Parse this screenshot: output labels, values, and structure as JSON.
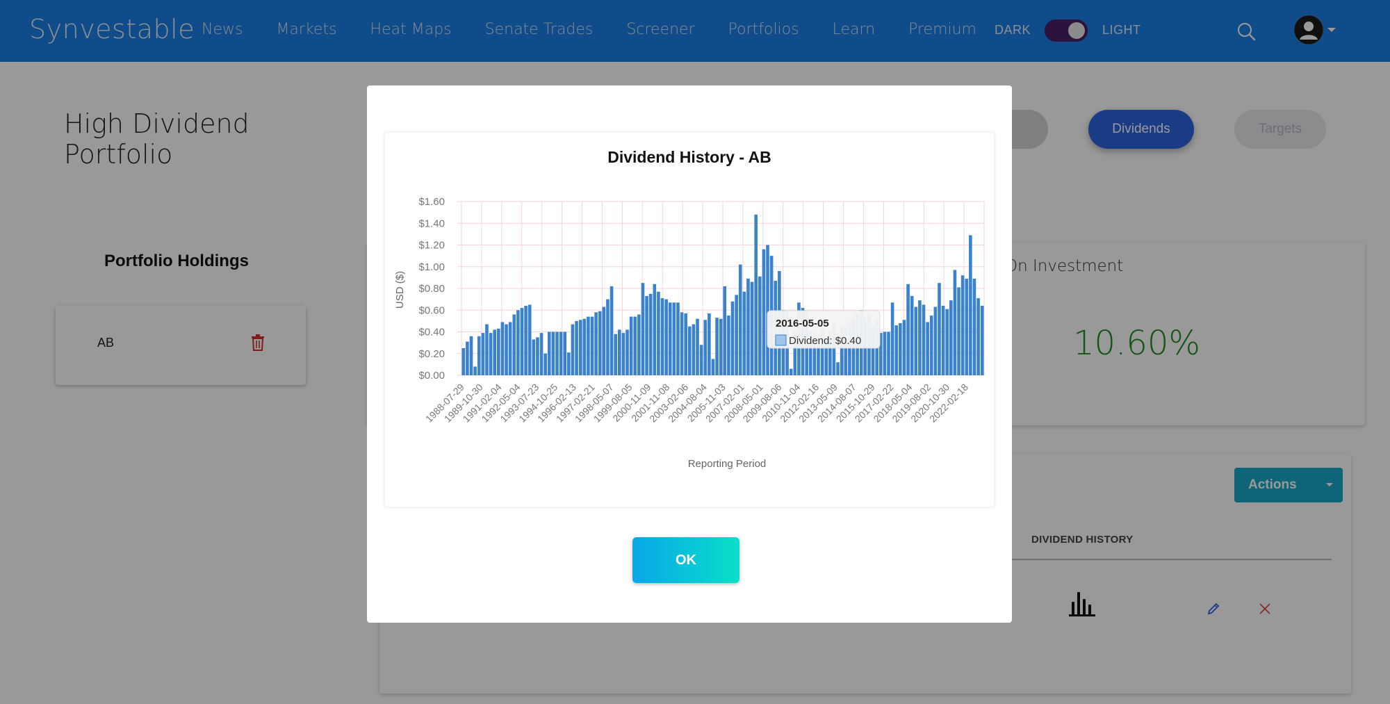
{
  "brand": "Synvestable",
  "nav": {
    "items": [
      "News",
      "Markets",
      "Heat Maps",
      "Senate Trades",
      "Screener",
      "Portfolios",
      "Learn",
      "Premium"
    ],
    "dark_label": "DARK",
    "light_label": "LIGHT"
  },
  "page": {
    "title_line1": "High Dividend",
    "title_line2": "Portfolio",
    "tabs": {
      "dividends": "Dividends",
      "targets": "Targets"
    },
    "holdings_title": "Portfolio Holdings",
    "holdings": [
      {
        "symbol": "AB"
      }
    ],
    "roi_label": "On Investment",
    "roi_value": "10.60%",
    "actions_label": "Actions",
    "column_header": "DIVIDEND HISTORY"
  },
  "modal": {
    "ok_label": "OK",
    "tooltip": {
      "date": "2016-05-05",
      "label": "Dividend: $0.40"
    }
  },
  "colors": {
    "nav_bg": "#1b7fe5",
    "bar": "#3a82cc",
    "roi_positive": "#1e8c1e",
    "dividends_tab": "#2c63e0"
  },
  "chart_data": {
    "type": "bar",
    "title": "Dividend History - AB",
    "xlabel": "Reporting Period",
    "ylabel": "USD ($)",
    "ylim": [
      0,
      1.6
    ],
    "y_ticks": [
      "$0.00",
      "$0.20",
      "$0.40",
      "$0.60",
      "$0.80",
      "$1.00",
      "$1.20",
      "$1.40",
      "$1.60"
    ],
    "x_tick_labels": [
      "1988-07-29",
      "1989-10-30",
      "1991-02-04",
      "1992-05-04",
      "1993-07-23",
      "1994-10-25",
      "1996-02-13",
      "1997-02-21",
      "1998-05-07",
      "1999-08-05",
      "2000-11-09",
      "2001-11-08",
      "2003-02-06",
      "2004-08-04",
      "2005-11-03",
      "2007-02-01",
      "2008-05-01",
      "2009-08-06",
      "2010-11-04",
      "2012-02-16",
      "2013-05-09",
      "2014-08-07",
      "2015-10-29",
      "2017-02-22",
      "2018-05-04",
      "2019-08-02",
      "2020-10-30",
      "2022-02-18"
    ],
    "series": [
      {
        "values": [
          0.25,
          0.31,
          0.36,
          0.08,
          0.36,
          0.39,
          0.47,
          0.39,
          0.42,
          0.43,
          0.49,
          0.47,
          0.49,
          0.56,
          0.6,
          0.62,
          0.64,
          0.65,
          0.33,
          0.35,
          0.39,
          0.2,
          0.4,
          0.4,
          0.4,
          0.4,
          0.4,
          0.21,
          0.47,
          0.5,
          0.51,
          0.52,
          0.54,
          0.54,
          0.58,
          0.59,
          0.63,
          0.7,
          0.82,
          0.38,
          0.42,
          0.39,
          0.42,
          0.54,
          0.54,
          0.56,
          0.85,
          0.73,
          0.75,
          0.84,
          0.77,
          0.71,
          0.7,
          0.67,
          0.67,
          0.67,
          0.58,
          0.57,
          0.45,
          0.47,
          0.52,
          0.28,
          0.51,
          0.57,
          0.15,
          0.53,
          0.52,
          0.82,
          0.55,
          0.68,
          0.74,
          1.02,
          0.77,
          0.89,
          0.86,
          1.48,
          0.91,
          1.16,
          1.2,
          1.1,
          0.87,
          0.96,
          0.6,
          0.59,
          0.06,
          0.41,
          0.67,
          0.62,
          0.58,
          0.41,
          0.39,
          0.29,
          0.43,
          0.34,
          0.4,
          0.48,
          0.12,
          0.45,
          0.45,
          0.5,
          0.53,
          0.57,
          0.6,
          0.53,
          0.55,
          0.46,
          0.5,
          0.39,
          0.4,
          0.4,
          0.67,
          0.46,
          0.48,
          0.51,
          0.84,
          0.73,
          0.63,
          0.69,
          0.65,
          0.49,
          0.55,
          0.63,
          0.85,
          0.64,
          0.61,
          0.69,
          0.97,
          0.81,
          0.92,
          0.89,
          1.29,
          0.89,
          0.71,
          0.64
        ]
      }
    ],
    "hover": {
      "category": "2016-05-05",
      "value": 0.4
    }
  }
}
